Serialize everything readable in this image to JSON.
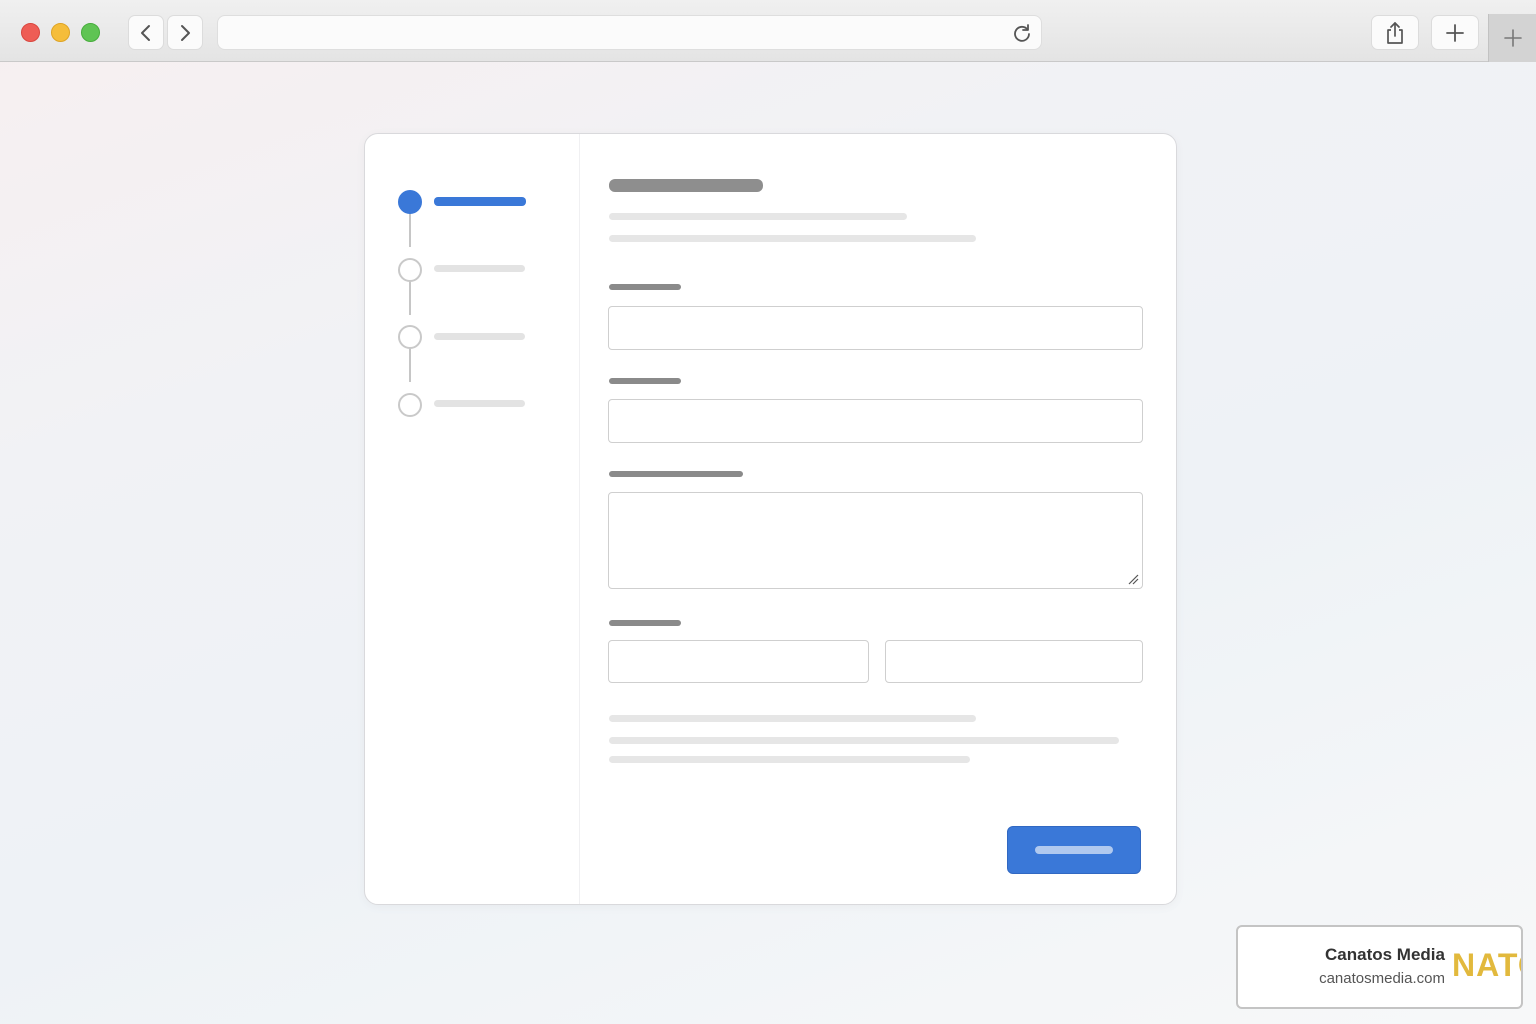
{
  "browser": {
    "url": "",
    "buttons": [
      "back",
      "forward",
      "reload",
      "share",
      "new-tab",
      "tab-overview"
    ]
  },
  "wizard": {
    "steps": [
      {
        "state": "active"
      },
      {
        "state": "inactive"
      },
      {
        "state": "inactive"
      },
      {
        "state": "inactive"
      }
    ],
    "current_step": 1,
    "total_steps": 4,
    "fields": [
      {
        "type": "text-input",
        "value": ""
      },
      {
        "type": "text-input",
        "value": ""
      },
      {
        "type": "textarea",
        "value": ""
      },
      {
        "type": "split-inputs",
        "values": [
          "",
          ""
        ]
      }
    ],
    "accent_color": "#3a78d8"
  },
  "watermark": {
    "name": "Canatos Media",
    "url": "canatosmedia.com",
    "logo_text": "NATO"
  }
}
